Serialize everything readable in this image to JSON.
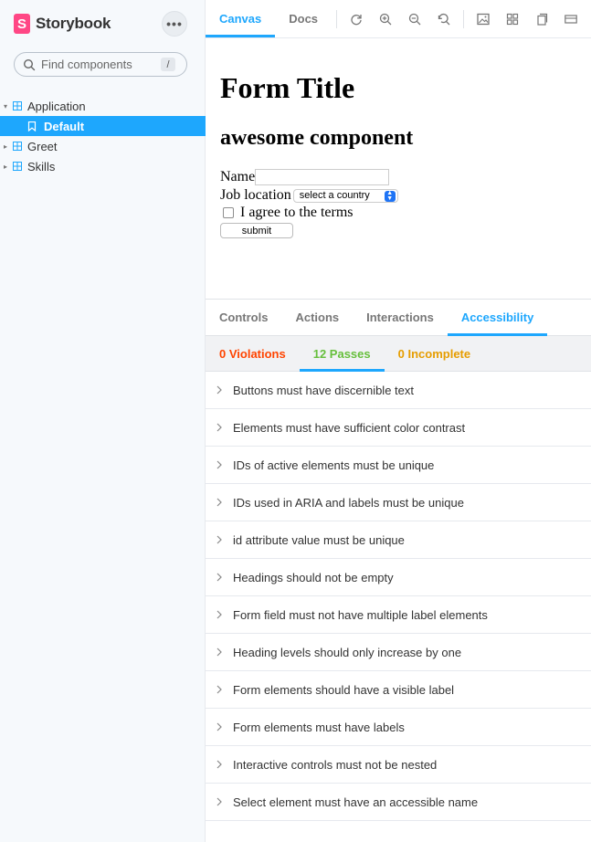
{
  "brand": {
    "name": "Storybook",
    "logo_letter": "S",
    "color": "#ff4785"
  },
  "sidebar": {
    "menu_label": "•••",
    "search": {
      "placeholder": "Find components",
      "shortcut": "/"
    },
    "tree": [
      {
        "label": "Application",
        "type": "component",
        "expanded": true
      },
      {
        "label": "Default",
        "type": "story",
        "selected": true
      },
      {
        "label": "Greet",
        "type": "component",
        "expanded": false
      },
      {
        "label": "Skills",
        "type": "component",
        "expanded": false
      }
    ]
  },
  "toolbar": {
    "tabs": [
      {
        "label": "Canvas",
        "active": true
      },
      {
        "label": "Docs",
        "active": false
      }
    ],
    "icons": [
      "reload-icon",
      "zoom-in-icon",
      "zoom-out-icon",
      "zoom-reset-icon",
      "background-icon",
      "grid-icon",
      "viewport-icon",
      "measure-icon"
    ]
  },
  "canvas": {
    "title": "Form Title",
    "subtitle": "awesome component",
    "name_label": "Name",
    "job_label": "Job location",
    "select_value": "select a country",
    "agree_label": "I agree to the terms",
    "submit_label": "submit"
  },
  "panel": {
    "tabs": [
      {
        "label": "Controls",
        "active": false
      },
      {
        "label": "Actions",
        "active": false
      },
      {
        "label": "Interactions",
        "active": false
      },
      {
        "label": "Accessibility",
        "active": true
      }
    ],
    "accessibility": {
      "violations": "0 Violations",
      "passes": "12 Passes",
      "incomplete": "0 Incomplete",
      "rules": [
        "Buttons must have discernible text",
        "Elements must have sufficient color contrast",
        "IDs of active elements must be unique",
        "IDs used in ARIA and labels must be unique",
        "id attribute value must be unique",
        "Headings should not be empty",
        "Form field must not have multiple label elements",
        "Heading levels should only increase by one",
        "Form elements should have a visible label",
        "Form elements must have labels",
        "Interactive controls must not be nested",
        "Select element must have an accessible name"
      ]
    }
  },
  "colors": {
    "accent": "#1ea7fd",
    "violations": "#ff4400",
    "passes": "#66bf3c",
    "incomplete": "#e69d00"
  }
}
